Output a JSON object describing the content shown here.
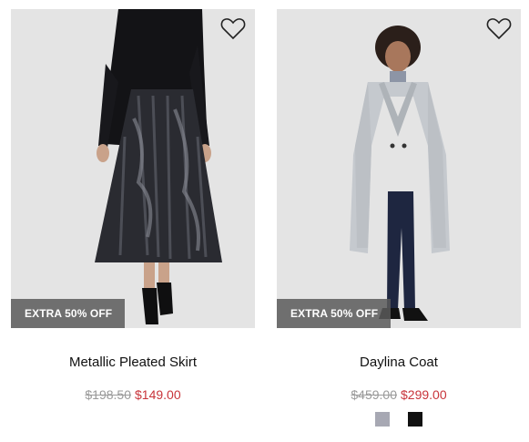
{
  "products": [
    {
      "name": "Metallic Pleated Skirt",
      "badge": "EXTRA 50% OFF",
      "old_price": "$198.50",
      "new_price": "$149.00",
      "image": "model in black turtleneck and metallic pleated skirt",
      "swatches": []
    },
    {
      "name": "Daylina Coat",
      "badge": "EXTRA 50% OFF",
      "old_price": "$459.00",
      "new_price": "$299.00",
      "image": "model in light grey long coat",
      "swatches": [
        {
          "color": "#a7a8b3",
          "name": "light grey"
        },
        {
          "color": "#111111",
          "name": "black"
        }
      ]
    }
  ],
  "icons": {
    "wishlist": "heart-outline-icon"
  },
  "colors": {
    "sale_price": "#c8343a",
    "old_price": "#9a9a9a",
    "badge_bg": "#5a5a5a"
  }
}
